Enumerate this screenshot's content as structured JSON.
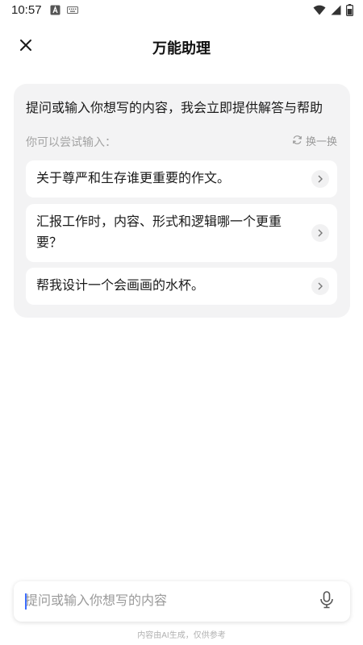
{
  "status_bar": {
    "time": "10:57",
    "left_icons": [
      "a-badge-icon",
      "keyboard-icon"
    ],
    "right_icons": [
      "wifi-icon",
      "signal-icon",
      "battery-icon"
    ]
  },
  "header": {
    "title": "万能助理",
    "close_icon": "close-icon"
  },
  "card": {
    "intro": "提问或输入你想写的内容，我会立即提供解答与帮助",
    "try_label": "你可以尝试输入：",
    "refresh_label": "换一换",
    "suggestions": [
      {
        "text": "关于尊严和生存谁更重要的作文。"
      },
      {
        "text": "汇报工作时，内容、形式和逻辑哪一个更重要？"
      },
      {
        "text": "帮我设计一个会画画的水杯。"
      }
    ]
  },
  "input": {
    "placeholder": "提问或输入你想写的内容",
    "value": ""
  },
  "disclaimer": "内容由AI生成，仅供参考",
  "colors": {
    "card_bg": "#f3f3f4",
    "caret": "#3d6dff",
    "muted_text": "#a3a3a3"
  }
}
